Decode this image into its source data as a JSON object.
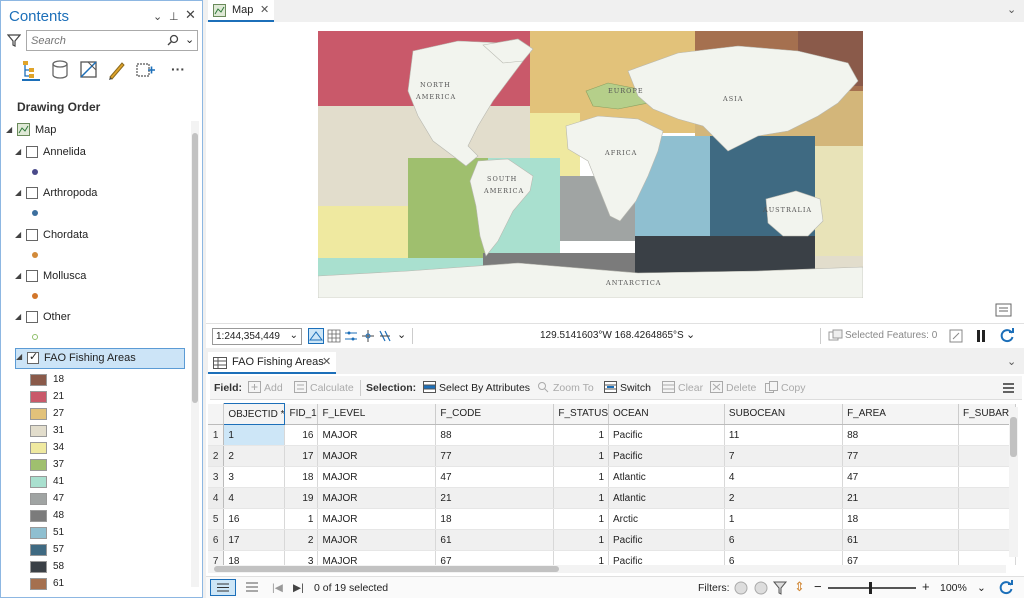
{
  "contents": {
    "title": "Contents",
    "search_placeholder": "Search",
    "section_title": "Drawing Order",
    "map_label": "Map",
    "layers": [
      {
        "name": "Annelida",
        "checked": false,
        "dot": "#4a4a8a"
      },
      {
        "name": "Arthropoda",
        "checked": false,
        "dot": "#3c6f9e"
      },
      {
        "name": "Chordata",
        "checked": false,
        "dot": "#d28a3a"
      },
      {
        "name": "Mollusca",
        "checked": false,
        "dot": "#d2762a"
      },
      {
        "name": "Other",
        "checked": false,
        "dot": "#8fbf6a"
      },
      {
        "name": "FAO Fishing Areas",
        "checked": true
      }
    ],
    "legend": [
      {
        "label": "18",
        "color": "#8a5a4a"
      },
      {
        "label": "21",
        "color": "#c9596a"
      },
      {
        "label": "27",
        "color": "#e2c27a"
      },
      {
        "label": "31",
        "color": "#e2ddcc"
      },
      {
        "label": "34",
        "color": "#efe9a0"
      },
      {
        "label": "37",
        "color": "#9fbf6e"
      },
      {
        "label": "41",
        "color": "#a9e0cf"
      },
      {
        "label": "47",
        "color": "#a0a4a3"
      },
      {
        "label": "48",
        "color": "#7b7b7b"
      },
      {
        "label": "51",
        "color": "#8fbfd0"
      },
      {
        "label": "57",
        "color": "#3f6a82"
      },
      {
        "label": "58",
        "color": "#3a4046"
      },
      {
        "label": "61",
        "color": "#a5704f"
      }
    ]
  },
  "map": {
    "tab_label": "Map",
    "labels": {
      "north_america_1": "NORTH",
      "north_america_2": "AMERICA",
      "europe": "EUROPE",
      "asia": "ASIA",
      "africa": "AFRICA",
      "south_america_1": "SOUTH",
      "south_america_2": "AMERICA",
      "australia": "AUSTRALIA",
      "antarctica": "ANTARCTICA"
    },
    "scale": "1:244,354,449",
    "coordinates": "129.5141603°W 168.4264865°S",
    "selected_features": "Selected Features: 0"
  },
  "table": {
    "tab_label": "FAO Fishing Areas",
    "toolbar": {
      "field_label": "Field:",
      "add": "Add",
      "calculate": "Calculate",
      "selection_label": "Selection:",
      "select_by_attributes": "Select By Attributes",
      "zoom_to": "Zoom To",
      "switch": "Switch",
      "clear": "Clear",
      "delete": "Delete",
      "copy": "Copy"
    },
    "columns": [
      "OBJECTID *",
      "FID_1",
      "F_LEVEL",
      "F_CODE",
      "F_STATUS",
      "OCEAN",
      "SUBOCEAN",
      "F_AREA",
      "F_SUBAR"
    ],
    "rows": [
      [
        "1",
        "1",
        "16",
        "MAJOR",
        "88",
        "1",
        "Pacific",
        "11",
        "88"
      ],
      [
        "2",
        "2",
        "17",
        "MAJOR",
        "77",
        "1",
        "Pacific",
        "7",
        "77"
      ],
      [
        "3",
        "3",
        "18",
        "MAJOR",
        "47",
        "1",
        "Atlantic",
        "4",
        "47"
      ],
      [
        "4",
        "4",
        "19",
        "MAJOR",
        "21",
        "1",
        "Atlantic",
        "2",
        "21"
      ],
      [
        "5",
        "16",
        "1",
        "MAJOR",
        "18",
        "1",
        "Arctic",
        "1",
        "18"
      ],
      [
        "6",
        "17",
        "2",
        "MAJOR",
        "61",
        "1",
        "Pacific",
        "6",
        "61"
      ],
      [
        "7",
        "18",
        "3",
        "MAJOR",
        "67",
        "1",
        "Pacific",
        "6",
        "67"
      ]
    ],
    "status": "0 of 19 selected",
    "filters_label": "Filters:",
    "zoom": "100%"
  }
}
